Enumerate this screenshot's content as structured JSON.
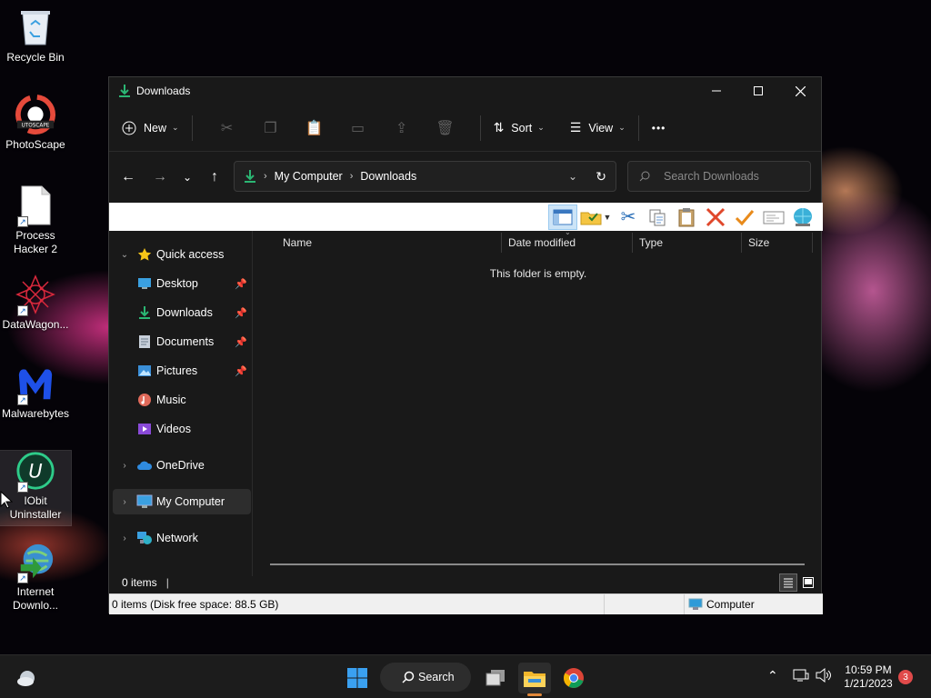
{
  "desktop": {
    "icons": [
      {
        "label": "Recycle Bin",
        "icon": "recycle-bin-icon"
      },
      {
        "label": "PhotoScape",
        "icon": "photoscape-icon"
      },
      {
        "label": "Process Hacker 2",
        "icon": "document-icon"
      },
      {
        "label": "DataWagon...",
        "icon": "datawagon-icon"
      },
      {
        "label": "Malwarebytes",
        "icon": "malwarebytes-icon"
      },
      {
        "label": "IObit Uninstaller",
        "icon": "iobit-uninstaller-icon"
      },
      {
        "label": "Internet Downlo...",
        "icon": "internet-download-manager-icon"
      }
    ]
  },
  "window": {
    "title": "Downloads",
    "toolbar": {
      "new_label": "New",
      "sort_label": "Sort",
      "view_label": "View",
      "more_label": "•••"
    },
    "address": {
      "crumbs": [
        "My Computer",
        "Downloads"
      ],
      "search_placeholder": "Search Downloads"
    },
    "nav": {
      "quick_access": "Quick access",
      "pinned": [
        {
          "label": "Desktop",
          "icon": "desktop-folder-icon",
          "pinned": true
        },
        {
          "label": "Downloads",
          "icon": "downloads-folder-icon",
          "pinned": true
        },
        {
          "label": "Documents",
          "icon": "documents-folder-icon",
          "pinned": true
        },
        {
          "label": "Pictures",
          "icon": "pictures-folder-icon",
          "pinned": true
        },
        {
          "label": "Music",
          "icon": "music-folder-icon",
          "pinned": false
        },
        {
          "label": "Videos",
          "icon": "videos-folder-icon",
          "pinned": false
        }
      ],
      "onedrive": "OneDrive",
      "my_computer": "My Computer",
      "network": "Network"
    },
    "columns": [
      "Name",
      "Date modified",
      "Type",
      "Size"
    ],
    "empty_message": "This folder is empty.",
    "status_items": "0 items",
    "legacy_status": {
      "left": "0 items (Disk free space: 88.5 GB)",
      "right": "Computer"
    }
  },
  "taskbar": {
    "search_label": "Search",
    "time": "10:59 PM",
    "date": "1/21/2023",
    "notification_count": "3"
  },
  "colors": {
    "accent_green": "#2bb673",
    "window_bg": "#191919",
    "taskbar_bg": "#1c1c1c"
  }
}
